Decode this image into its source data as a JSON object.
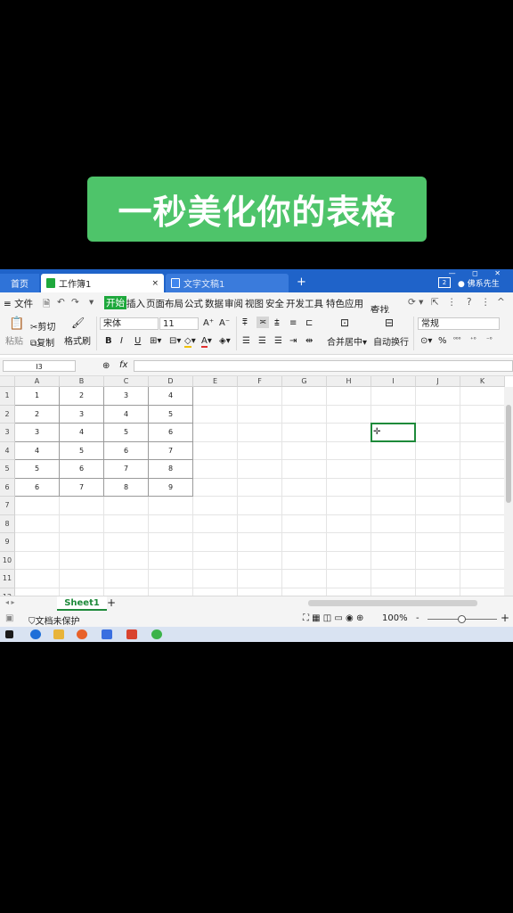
{
  "banner": "一秒美化你的表格",
  "titlebar": {
    "home_tab": "首页",
    "workbook_tab": "工作簿1",
    "doc_tab": "文字文稿1",
    "close_glyph": "×",
    "new_tab_glyph": "+",
    "user": "佛系先生"
  },
  "menu": {
    "file": "≡ 文件",
    "items": [
      "开始",
      "插入",
      "页面布局",
      "公式",
      "数据",
      "审阅",
      "视图",
      "安全",
      "开发工具",
      "特色应用"
    ],
    "search": "查找"
  },
  "ribbon": {
    "paste": "粘贴",
    "cut": "剪切",
    "copy": "复制",
    "format_painter": "格式刷",
    "font_name": "宋体",
    "font_size": "11",
    "bold": "B",
    "italic": "I",
    "underline": "U",
    "merge_center": "合并居中",
    "auto_wrap": "自动换行",
    "number_format": "常规",
    "percent": "%"
  },
  "formula": {
    "cell_ref": "I3",
    "fx": "fx"
  },
  "grid": {
    "columns": [
      "A",
      "B",
      "C",
      "D",
      "E",
      "F",
      "G",
      "H",
      "I",
      "J",
      "K"
    ],
    "rows": [
      "1",
      "2",
      "3",
      "4",
      "5",
      "6",
      "7",
      "8",
      "9",
      "10",
      "11",
      "12"
    ],
    "values": [
      [
        "1",
        "2",
        "3",
        "4"
      ],
      [
        "2",
        "3",
        "4",
        "5"
      ],
      [
        "3",
        "4",
        "5",
        "6"
      ],
      [
        "4",
        "5",
        "6",
        "7"
      ],
      [
        "5",
        "6",
        "7",
        "8"
      ],
      [
        "6",
        "7",
        "8",
        "9"
      ]
    ],
    "selected": "I3"
  },
  "sheets": {
    "active": "Sheet1",
    "add": "+"
  },
  "status": {
    "protect": "文档未保护",
    "zoom": "100%",
    "minus": "-",
    "plus": "+"
  },
  "colors": {
    "accent": "#1e8a3a",
    "titlebar": "#1f63c9",
    "banner": "#4ec46a"
  }
}
